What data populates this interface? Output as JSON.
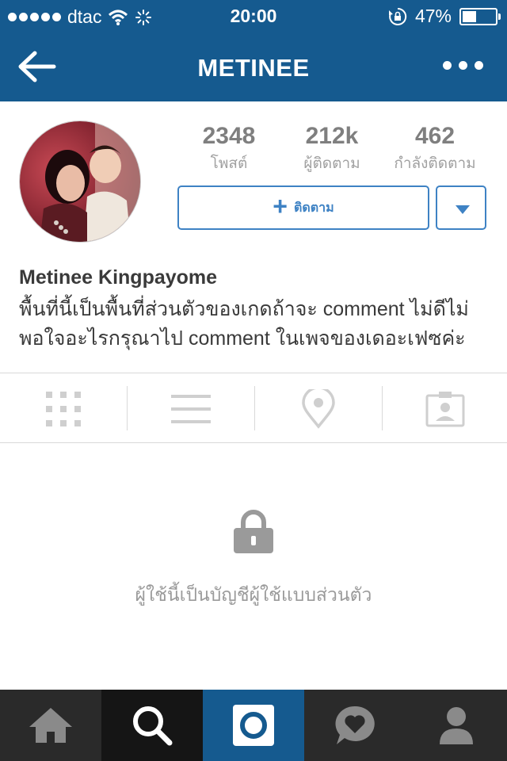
{
  "status_bar": {
    "carrier": "dtac",
    "time": "20:00",
    "battery_percent": "47%",
    "battery_level": 0.47
  },
  "nav": {
    "title": "METINEE"
  },
  "profile": {
    "stats": [
      {
        "value": "2348",
        "label": "โพสต์"
      },
      {
        "value": "212k",
        "label": "ผู้ติดตาม"
      },
      {
        "value": "462",
        "label": "กำลังติดตาม"
      }
    ],
    "follow_button_label": "ติดตาม",
    "name": "Metinee Kingpayome",
    "bio_line1": "พื้นที่นี้เป็นพื้นที่ส่วนตัวของเกดถ้าจะ comment ไม่ดีไม่",
    "bio_line2": "พอใจอะไรกรุณาไป comment ในเพจของเดอะเฟซค่ะ"
  },
  "view_tabs": [
    {
      "icon": "grid-icon"
    },
    {
      "icon": "list-icon"
    },
    {
      "icon": "location-pin-icon"
    },
    {
      "icon": "tagged-photos-icon"
    }
  ],
  "private_message": "ผู้ใช้นี้เป็นบัญชีผู้ใช้แบบส่วนตัว",
  "bottom_nav": [
    {
      "icon": "home-icon"
    },
    {
      "icon": "search-icon",
      "active": true
    },
    {
      "icon": "camera-icon"
    },
    {
      "icon": "activity-heart-icon"
    },
    {
      "icon": "profile-icon"
    }
  ],
  "colors": {
    "header_blue": "#155a8f",
    "accent_blue": "#3e82c4",
    "bottom_bar": "#2a2a2a",
    "bottom_bar_active": "#151515",
    "camera_tab": "#155a8f"
  }
}
